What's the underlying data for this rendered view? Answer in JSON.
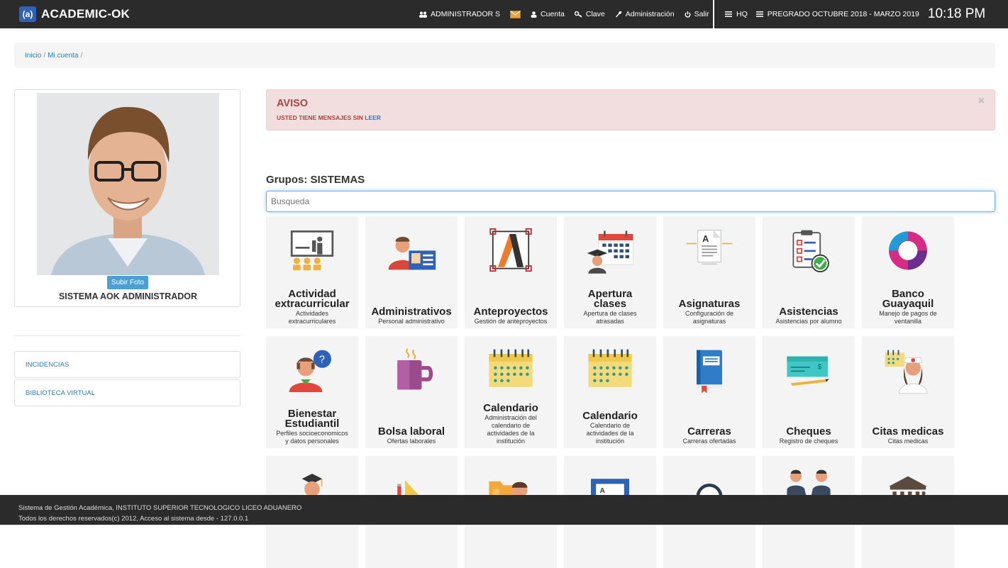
{
  "header": {
    "logo_text": "(a)",
    "brand": "ACADEMIC-OK",
    "nav": [
      {
        "icon": "users-icon",
        "label": "ADMINISTRADOR S"
      },
      {
        "icon": "user-icon",
        "label": "Cuenta"
      },
      {
        "icon": "key-icon",
        "label": "Clave"
      },
      {
        "icon": "wrench-icon",
        "label": "Administración"
      },
      {
        "icon": "power-icon",
        "label": "Salir"
      }
    ],
    "campus": "HQ",
    "period": "PREGRADO OCTUBRE 2018 - MARZO 2019",
    "clock": "10:18 PM"
  },
  "breadcrumb": [
    "Inicio",
    "Mi cuenta"
  ],
  "profile": {
    "upload_label": "Subir Foto",
    "name": "SISTEMA AOK ADMINISTRADOR"
  },
  "side_links": [
    "INCIDENCIAS",
    "BIBLIOTECA VIRTUAL"
  ],
  "alert": {
    "title": "AVISO",
    "message": "USTED TIENE MENSAJES SIN",
    "link": "LEER",
    "close": "×"
  },
  "groups": {
    "title": "Grupos: SISTEMAS",
    "search_placeholder": "Busqueda"
  },
  "tiles": [
    {
      "name": [
        "Actividad",
        "extracurricular"
      ],
      "desc": [
        "Actividades",
        "extracurriculares"
      ],
      "icon": "presentation-icon"
    },
    {
      "name": [
        "Administrativos"
      ],
      "desc": [
        "Personal administrativo"
      ],
      "icon": "id-card-icon"
    },
    {
      "name": [
        "Anteproyectos"
      ],
      "desc": [
        "Gestión de anteproyectos"
      ],
      "icon": "vector-a-icon"
    },
    {
      "name": [
        "Apertura",
        "clases"
      ],
      "desc": [
        "Apertura de clases",
        "atrasadas"
      ],
      "icon": "calendar-graduate-icon"
    },
    {
      "name": [
        "Asignaturas"
      ],
      "desc": [
        "Configuración de",
        "asignaturas"
      ],
      "icon": "document-icon"
    },
    {
      "name": [
        "Asistencias"
      ],
      "desc": [
        "Asistencias por alumno"
      ],
      "icon": "checklist-icon"
    },
    {
      "name": [
        "Banco",
        "Guayaquil"
      ],
      "desc": [
        "Manejo de pagos de",
        "ventanilla"
      ],
      "icon": "bank-logo-icon"
    },
    {
      "name": [
        "Bienestar",
        "Estudiantil"
      ],
      "desc": [
        "Perfiles socioeconomicos",
        "y datos personales"
      ],
      "icon": "student-question-icon"
    },
    {
      "name": [
        "Bolsa laboral"
      ],
      "desc": [
        "Ofertas laborales"
      ],
      "icon": "coffee-mug-icon"
    },
    {
      "name": [
        "Calendario"
      ],
      "desc": [
        "Administración del",
        "calendario de",
        "actividades de la",
        "institución"
      ],
      "icon": "calendar-icon"
    },
    {
      "name": [
        "Calendario"
      ],
      "desc": [
        "Calendario de",
        "actividades de la",
        "institución"
      ],
      "icon": "calendar-icon"
    },
    {
      "name": [
        "Carreras"
      ],
      "desc": [
        "Carreras ofertadas"
      ],
      "icon": "book-icon"
    },
    {
      "name": [
        "Cheques"
      ],
      "desc": [
        "Registro de cheques"
      ],
      "icon": "cheque-icon"
    },
    {
      "name": [
        "Citas medicas"
      ],
      "desc": [
        "Citas medicas"
      ],
      "icon": "nurse-icon"
    },
    {
      "name": [],
      "desc": [],
      "icon": "graduate-icon"
    },
    {
      "name": [],
      "desc": [],
      "icon": "ruler-pencil-icon"
    },
    {
      "name": [],
      "desc": [],
      "icon": "folder-person-icon"
    },
    {
      "name": [],
      "desc": [],
      "icon": "blackboard-icon"
    },
    {
      "name": [],
      "desc": [],
      "icon": "magnifier-icon"
    },
    {
      "name": [],
      "desc": [],
      "icon": "handshake-icon"
    },
    {
      "name": [],
      "desc": [],
      "icon": "institution-icon"
    }
  ],
  "footer": {
    "line1": "Sistema de Gestión Académica, INSTITUTO SUPERIOR TECNOLOGICO LICEO ADUANERO",
    "line2": "Todos los derechos reservados(c) 2012, Acceso al sistema desde - 127.0.0.1"
  }
}
